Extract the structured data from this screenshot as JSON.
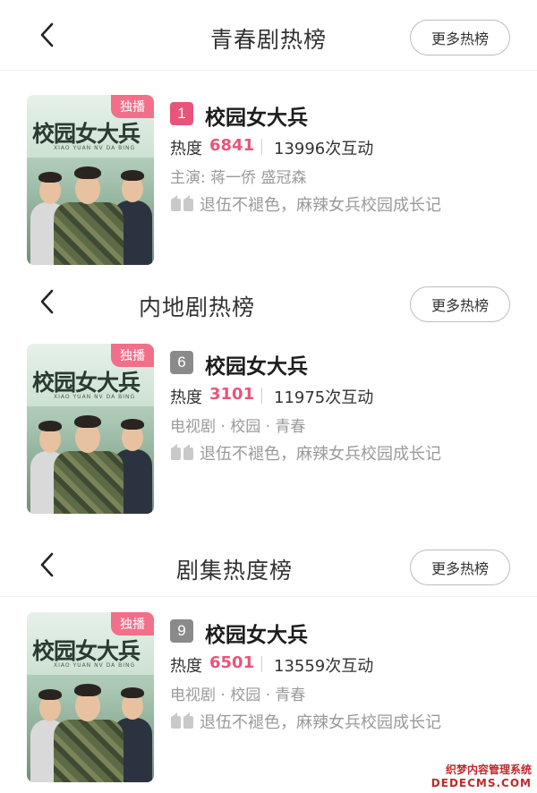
{
  "sections": [
    {
      "title": "青春剧热榜",
      "more_label": "更多热榜",
      "item": {
        "rank": "1",
        "name": "校园女大兵",
        "badge": "独播",
        "heat_label": "热度",
        "heat_value": "6841",
        "interactions": "13996次互动",
        "meta": "主演: 蒋一侨 盛冠森",
        "description": "退伍不褪色，麻辣女兵校园成长记"
      }
    },
    {
      "title": "内地剧热榜",
      "more_label": "更多热榜",
      "item": {
        "rank": "6",
        "name": "校园女大兵",
        "badge": "独播",
        "heat_label": "热度",
        "heat_value": "3101",
        "interactions": "11975次互动",
        "meta": "电视剧 · 校园 · 青春",
        "description": "退伍不褪色，麻辣女兵校园成长记"
      }
    },
    {
      "title": "剧集热度榜",
      "more_label": "更多热榜",
      "item": {
        "rank": "9",
        "name": "校园女大兵",
        "badge": "独播",
        "heat_label": "热度",
        "heat_value": "6501",
        "interactions": "13559次互动",
        "meta": "电视剧 · 校园 · 青春",
        "description": "退伍不褪色，麻辣女兵校园成长记"
      }
    }
  ],
  "poster": {
    "logo_text": "校园女大兵",
    "logo_subtext": "XIAO YUAN NV DA BING"
  },
  "watermark": {
    "line1": "织梦内容管理系统",
    "line2": "DEDECMS.COM"
  },
  "colors": {
    "accent": "#e8557a",
    "badge": "#f26f8a",
    "rank_gray": "#8a8a8a",
    "secondary_text": "#9a9a9a"
  }
}
